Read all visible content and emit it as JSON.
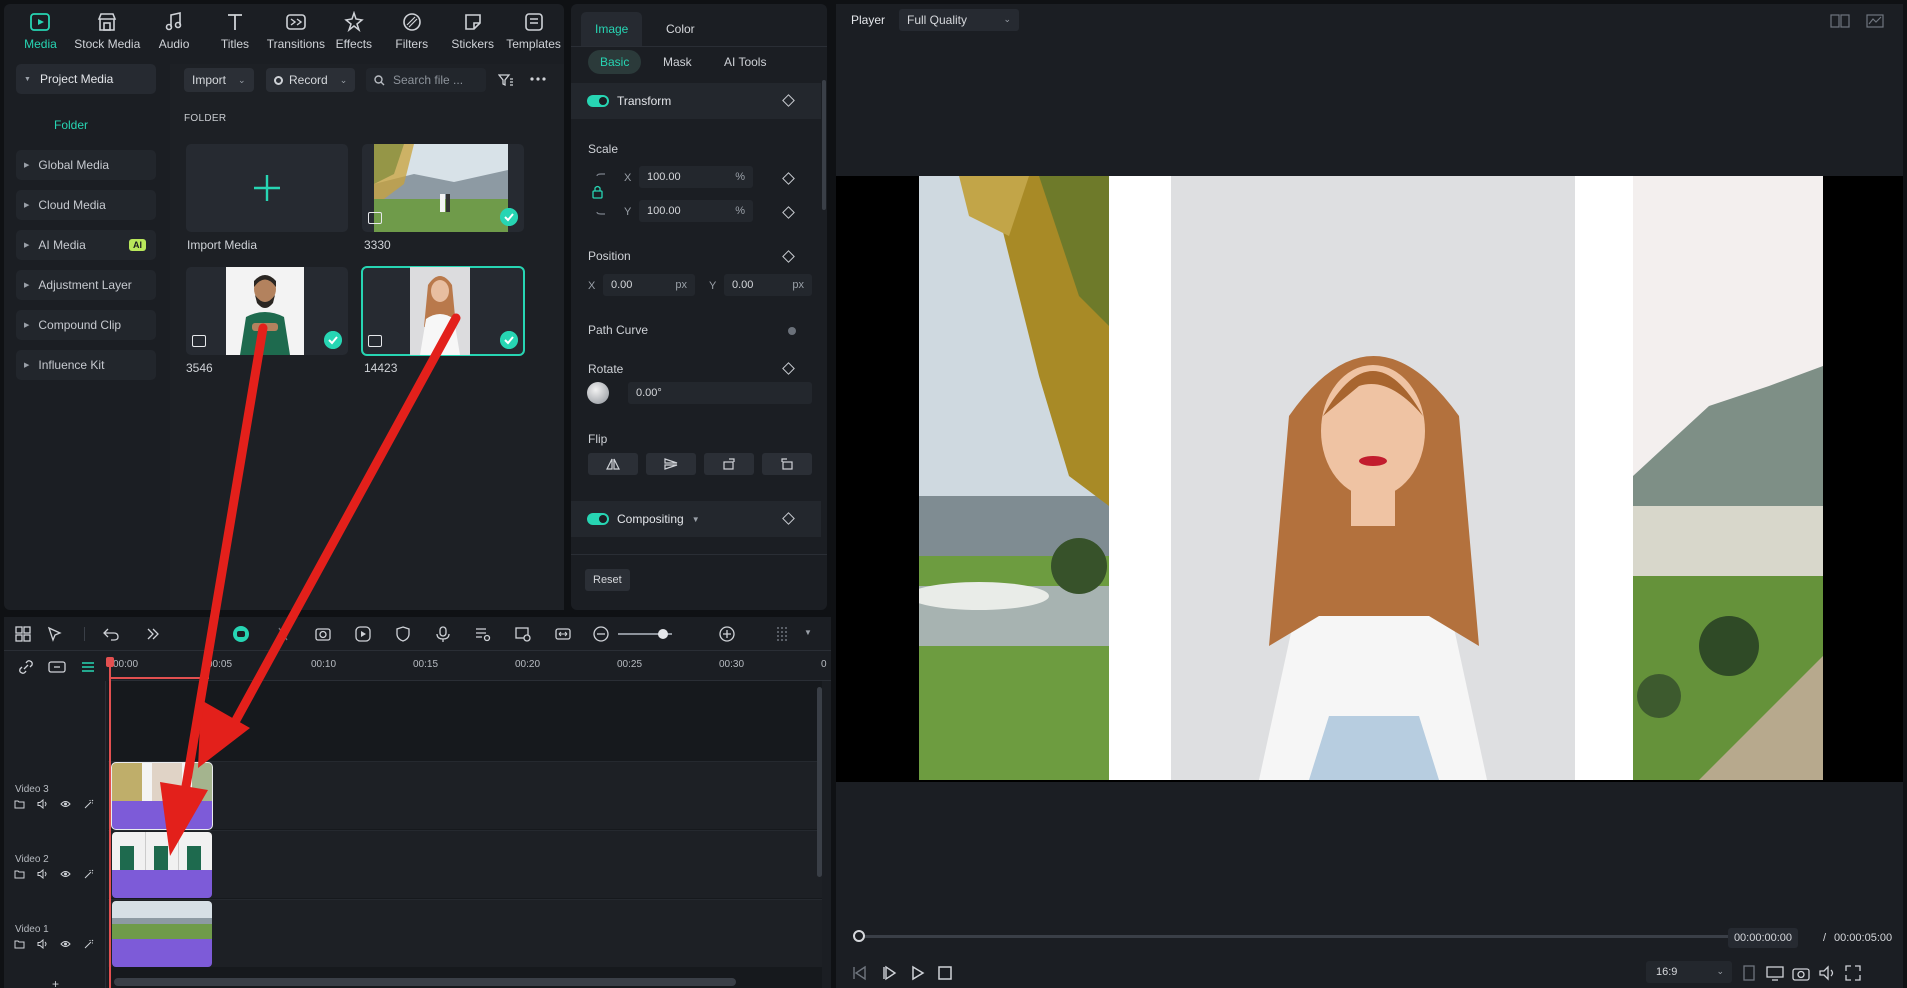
{
  "media_tabs": [
    {
      "label": "Media",
      "icon": "media-icon",
      "active": true
    },
    {
      "label": "Stock Media",
      "icon": "stock-media-icon"
    },
    {
      "label": "Audio",
      "icon": "music-note-icon"
    },
    {
      "label": "Titles",
      "icon": "text-t-icon"
    },
    {
      "label": "Transitions",
      "icon": "transitions-icon"
    },
    {
      "label": "Effects",
      "icon": "effects-icon"
    },
    {
      "label": "Filters",
      "icon": "filters-icon"
    },
    {
      "label": "Stickers",
      "icon": "stickers-icon"
    },
    {
      "label": "Templates",
      "icon": "templates-icon"
    }
  ],
  "side_nav": {
    "project_media": "Project Media",
    "folder": "Folder",
    "global_media": "Global Media",
    "cloud_media": "Cloud Media",
    "ai_media": "AI Media",
    "ai_badge": "AI",
    "adjustment_layer": "Adjustment Layer",
    "compound_clip": "Compound Clip",
    "influence_kit": "Influence Kit"
  },
  "media_toolbar": {
    "import": "Import",
    "record": "Record",
    "search_placeholder": "Search file ..."
  },
  "folder_label": "FOLDER",
  "media_items": {
    "import_media": "Import Media",
    "item1": "3330",
    "item2": "3546",
    "item3": "14423"
  },
  "props": {
    "tab_image": "Image",
    "tab_color": "Color",
    "sub_basic": "Basic",
    "sub_mask": "Mask",
    "sub_ai_tools": "AI Tools",
    "transform": "Transform",
    "scale": "Scale",
    "scale_x_label": "X",
    "scale_x": "100.00",
    "scale_y_label": "Y",
    "scale_y": "100.00",
    "percent": "%",
    "position": "Position",
    "pos_x_label": "X",
    "pos_x": "0.00",
    "pos_y_label": "Y",
    "pos_y": "0.00",
    "px": "px",
    "path_curve": "Path Curve",
    "rotate": "Rotate",
    "rotate_value": "0.00°",
    "flip": "Flip",
    "compositing": "Compositing",
    "reset": "Reset"
  },
  "player": {
    "title": "Player",
    "quality": "Full Quality",
    "current_time": "00:00:00:00",
    "separator": "/",
    "total_time": "00:00:05:00",
    "ratio": "16:9"
  },
  "timeline": {
    "ticks": [
      "00:00",
      "00:05",
      "00:10",
      "00:15",
      "00:20",
      "00:25",
      "00:30",
      "0"
    ],
    "tracks": [
      "Video 3",
      "Video 2",
      "Video 1"
    ],
    "add": "+"
  },
  "colors": {
    "accent": "#27d5b3",
    "clip_bar": "#7d5bd8",
    "playhead": "#e35050",
    "arrow": "#e3201b"
  }
}
